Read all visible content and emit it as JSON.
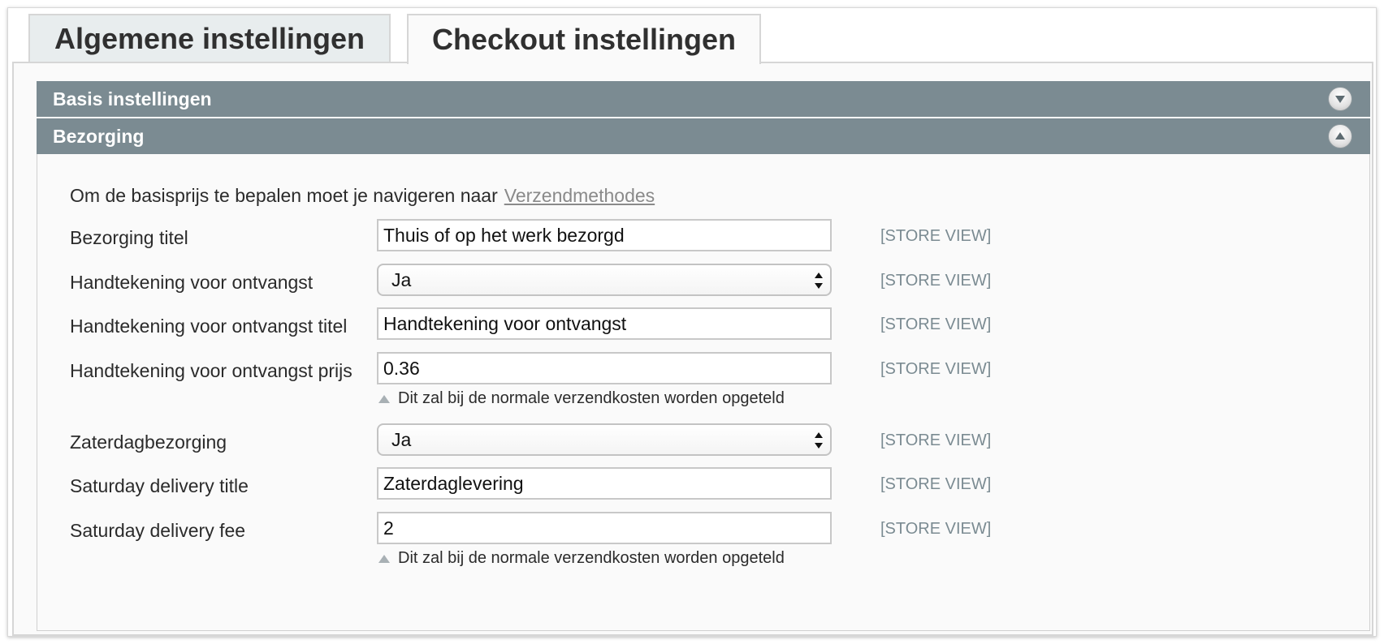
{
  "tabs": [
    {
      "label": "Algemene instellingen",
      "active": false
    },
    {
      "label": "Checkout instellingen",
      "active": true
    }
  ],
  "sections": {
    "basis": {
      "title": "Basis instellingen",
      "state": "collapsed",
      "icon": "chevron-down-icon"
    },
    "bezorging": {
      "title": "Bezorging",
      "state": "expanded",
      "icon": "chevron-up-icon"
    }
  },
  "bezorging": {
    "intro_text": "Om de basisprijs te bepalen moet je navigeren naar",
    "intro_link": "Verzendmethodes",
    "rows": [
      {
        "label": "Bezorging titel",
        "type": "text",
        "value": "Thuis of op het werk bezorgd",
        "scope": "[STORE VIEW]"
      },
      {
        "label": "Handtekening voor ontvangst",
        "type": "select",
        "value": "Ja",
        "scope": "[STORE VIEW]"
      },
      {
        "label": "Handtekening voor ontvangst titel",
        "type": "text",
        "value": "Handtekening voor ontvangst",
        "scope": "[STORE VIEW]"
      },
      {
        "label": "Handtekening voor ontvangst prijs",
        "type": "text",
        "value": "0.36",
        "scope": "[STORE VIEW]",
        "note": "Dit zal bij de normale verzendkosten worden opgeteld"
      },
      {
        "label": "Zaterdagbezorging",
        "type": "select",
        "value": "Ja",
        "scope": "[STORE VIEW]"
      },
      {
        "label": "Saturday delivery title",
        "type": "text",
        "value": "Zaterdaglevering",
        "scope": "[STORE VIEW]"
      },
      {
        "label": "Saturday delivery fee",
        "type": "text",
        "value": "2",
        "scope": "[STORE VIEW]",
        "note": "Dit zal bij de normale verzendkosten worden opgeteld"
      }
    ]
  },
  "colors": {
    "section_header_bg": "#7b8b92",
    "scope_text": "#7b8b92",
    "link": "#8a8a8a"
  }
}
